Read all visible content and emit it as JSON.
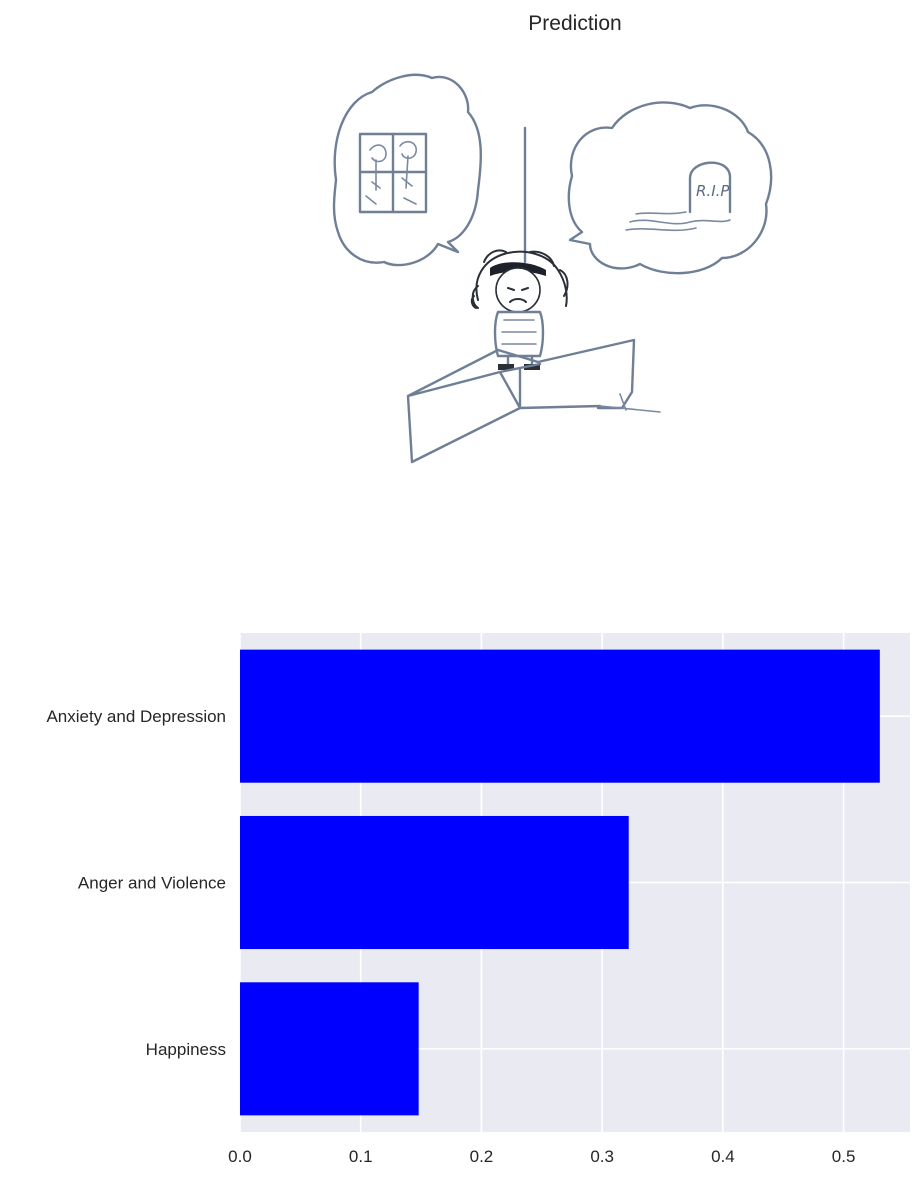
{
  "prediction_title": "Prediction",
  "drawing": {
    "headstone_text": "R.I.P"
  },
  "chart_data": {
    "type": "bar",
    "orientation": "horizontal",
    "categories": [
      "Anxiety and Depression",
      "Anger and Violence",
      "Happiness"
    ],
    "values": [
      0.53,
      0.322,
      0.148
    ],
    "xlim": [
      0,
      0.555
    ],
    "xticks": [
      "0.0",
      "0.1",
      "0.2",
      "0.3",
      "0.4",
      "0.5"
    ],
    "grid": true,
    "bar_color": "#0000ff",
    "background_color": "#eaeaf2",
    "grid_color": "#ffffff"
  }
}
